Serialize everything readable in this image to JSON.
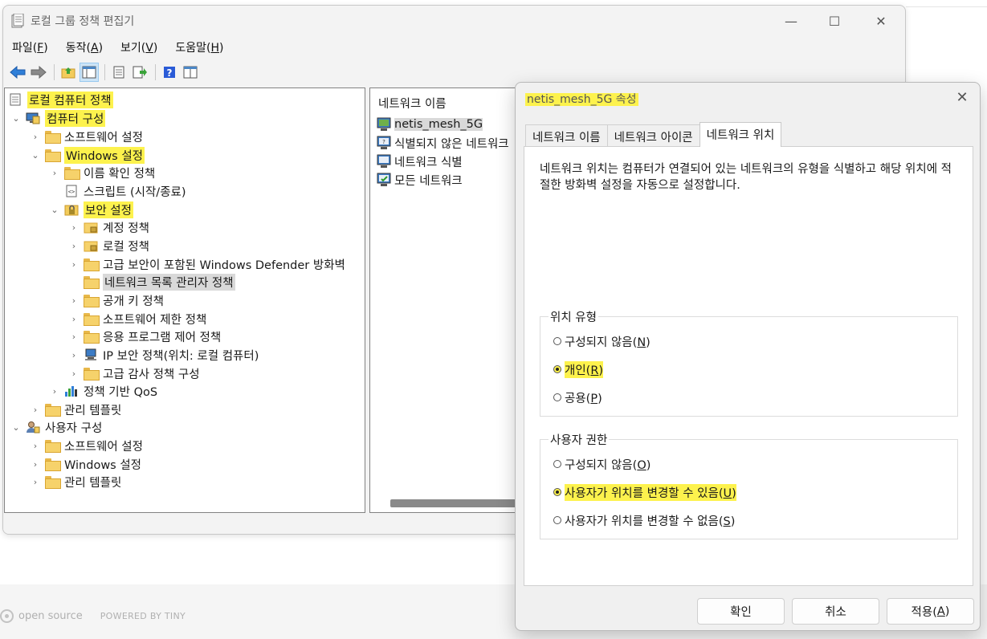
{
  "main_window": {
    "title": "로컬 그룹 정책 편집기",
    "controls": {
      "minimize": "—",
      "maximize": "☐",
      "close": "✕"
    },
    "menu": [
      {
        "label": "파일(",
        "key": "F",
        "end": ")"
      },
      {
        "label": "동작(",
        "key": "A",
        "end": ")"
      },
      {
        "label": "보기(",
        "key": "V",
        "end": ")"
      },
      {
        "label": "도움말(",
        "key": "H",
        "end": ")"
      }
    ],
    "toolbar_icons": [
      "back-arrow-icon",
      "forward-arrow-icon",
      "up-folder-icon",
      "show-hide-tree-icon",
      "properties-icon",
      "export-list-icon",
      "help-icon",
      "console-tree-icon"
    ]
  },
  "tree": {
    "root": "로컬 컴퓨터 정책",
    "computer_config": "컴퓨터 구성",
    "software_settings": "소프트웨어 설정",
    "windows_settings": "Windows 설정",
    "name_resolution": "이름 확인 정책",
    "scripts": "스크립트 (시작/종료)",
    "security_settings": "보안 설정",
    "account_policies": "계정 정책",
    "local_policies": "로컬 정책",
    "defender_firewall": "고급 보안이 포함된 Windows Defender 방화벽",
    "network_list_manager": "네트워크 목록 관리자 정책",
    "public_key": "공개 키 정책",
    "software_restriction": "소프트웨어 제한 정책",
    "app_control": "응용 프로그램 제어 정책",
    "ip_security": "IP 보안 정책(위치: 로컬 컴퓨터)",
    "audit_policy": "고급 감사 정책 구성",
    "qos": "정책 기반 QoS",
    "admin_templates": "관리 템플릿",
    "user_config": "사용자 구성",
    "user_software": "소프트웨어 설정",
    "user_windows": "Windows 설정",
    "user_admin_templates": "관리 템플릿"
  },
  "list": {
    "header": "네트워크 이름",
    "items": [
      "netis_mesh_5G",
      "식별되지 않은 네트워크",
      "네트워크 식별",
      "모든 네트워크"
    ]
  },
  "dialog": {
    "title": "netis_mesh_5G 속성",
    "close": "✕",
    "tabs": [
      "네트워크 이름",
      "네트워크 아이콘",
      "네트워크 위치"
    ],
    "description": "네트워크 위치는 컴퓨터가 연결되어 있는 네트워크의 유형을 식별하고 해당 위치에 적절한 방화벽 설정을 자동으로 설정합니다.",
    "location_group": "위치 유형",
    "location_options": [
      {
        "label": "구성되지 않음(",
        "key": "N",
        "end": ")",
        "checked": false
      },
      {
        "label": "개인(",
        "key": "R",
        "end": ")",
        "checked": true
      },
      {
        "label": "공용(",
        "key": "P",
        "end": ")",
        "checked": false
      }
    ],
    "permission_group": "사용자 권한",
    "permission_options": [
      {
        "label": "구성되지 않음(",
        "key": "O",
        "end": ")",
        "checked": false
      },
      {
        "label": "사용자가 위치를 변경할 수 있음(",
        "key": "U",
        "end": ")",
        "checked": true
      },
      {
        "label": "사용자가 위치를 변경할 수 없음(",
        "key": "S",
        "end": ")",
        "checked": false
      }
    ],
    "buttons": {
      "ok": "확인",
      "cancel": "취소",
      "apply": "적용(",
      "apply_key": "A",
      "apply_end": ")"
    }
  },
  "footer": {
    "open_source": "open source",
    "powered": "POWERED BY TINY"
  },
  "colors": {
    "highlight": "#fdf24d",
    "selection": "#d9d9d9",
    "accent": "#0067c0"
  }
}
